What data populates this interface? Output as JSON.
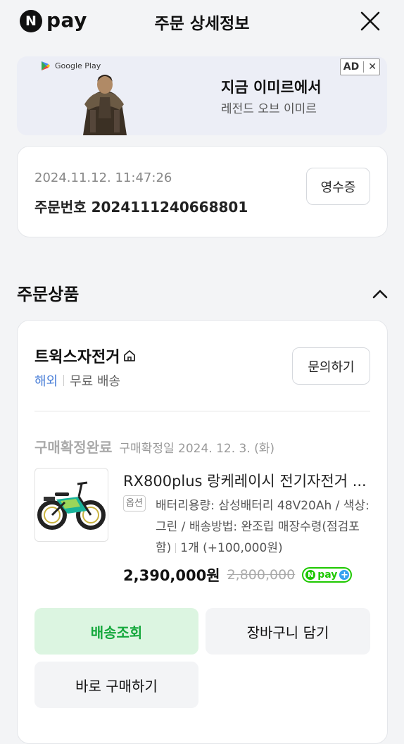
{
  "header": {
    "logo_n": "N",
    "logo_text": "pay",
    "title": "주문 상세정보"
  },
  "ad": {
    "store_label": "Google Play",
    "title": "지금 이미르에서",
    "subtitle": "레전드 오브 이미르",
    "badge": "AD",
    "close": "✕"
  },
  "order": {
    "datetime": "2024.11.12. 11:47:26",
    "number_label": "주문번호",
    "number": "2024111240668801",
    "receipt_label": "영수증"
  },
  "section": {
    "title": "주문상품"
  },
  "store": {
    "name": "트윅스자전거",
    "origin": "해외",
    "shipping": "무료 배송",
    "inquiry_label": "문의하기"
  },
  "item": {
    "status": "구매확정완료",
    "confirm_date": "구매확정일 2024. 12. 3. (화)",
    "name": "RX800plus 랑케레이시 전기자전거 ...",
    "option_tag": "옵션",
    "option_text": "배터리용량: 삼성배터리 48V20Ah / 색상: 그린 / 배송방법: 완조립 매장수령(점검포함)",
    "quantity": "1개 (+100,000원)",
    "price": "2,390,000원",
    "original_price": "2,800,000",
    "npay_n": "N",
    "npay_text": "pay",
    "npay_plus": "+"
  },
  "actions": {
    "track": "배송조회",
    "cart": "장바구니 담기",
    "buy": "바로 구매하기"
  },
  "colors": {
    "accent_green": "#1ec800",
    "track_bg": "#dcf5e1",
    "track_text": "#14a83c",
    "overseas_blue": "#4a7fd8"
  }
}
